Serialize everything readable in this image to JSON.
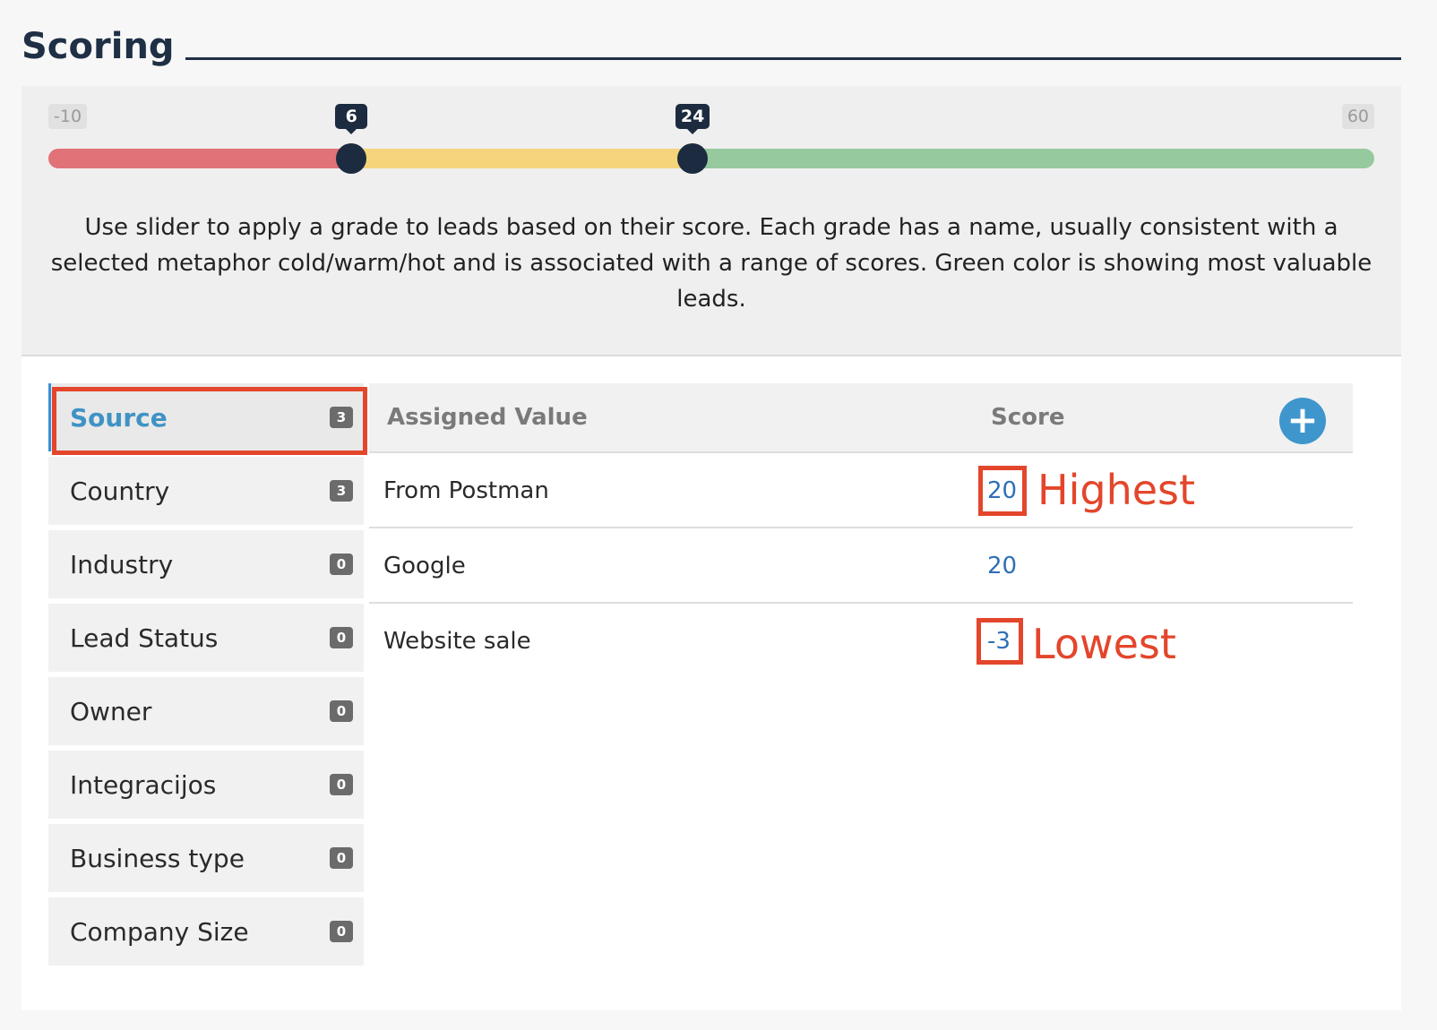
{
  "section": {
    "title": "Scoring"
  },
  "slider": {
    "min": -10,
    "max": 60,
    "thresholds": [
      6,
      24
    ],
    "min_label": "-10",
    "max_label": "60",
    "low_handle_label": "6",
    "high_handle_label": "24",
    "colors": {
      "cold": "#e07278",
      "warm": "#f5d47c",
      "hot": "#96c99d"
    },
    "description": "Use slider to apply a grade to leads based on their score. Each grade has a name, usually consistent with a selected metaphor cold/warm/hot and is associated with a range of scores. Green color is showing most valuable leads."
  },
  "categories": [
    {
      "label": "Source",
      "count": "3",
      "active": true
    },
    {
      "label": "Country",
      "count": "3"
    },
    {
      "label": "Industry",
      "count": "0"
    },
    {
      "label": "Lead Status",
      "count": "0"
    },
    {
      "label": "Owner",
      "count": "0"
    },
    {
      "label": "Integracijos",
      "count": "0"
    },
    {
      "label": "Business type",
      "count": "0"
    },
    {
      "label": "Company Size",
      "count": "0"
    }
  ],
  "table": {
    "headers": {
      "value": "Assigned Value",
      "score": "Score"
    },
    "add_icon": "plus-icon",
    "rows": [
      {
        "value": "From Postman",
        "score": "20"
      },
      {
        "value": "Google",
        "score": "20"
      },
      {
        "value": "Website sale",
        "score": "-3"
      }
    ]
  },
  "annotations": {
    "highest": "Highest",
    "lowest": "Lowest",
    "color": "#e3462b"
  }
}
